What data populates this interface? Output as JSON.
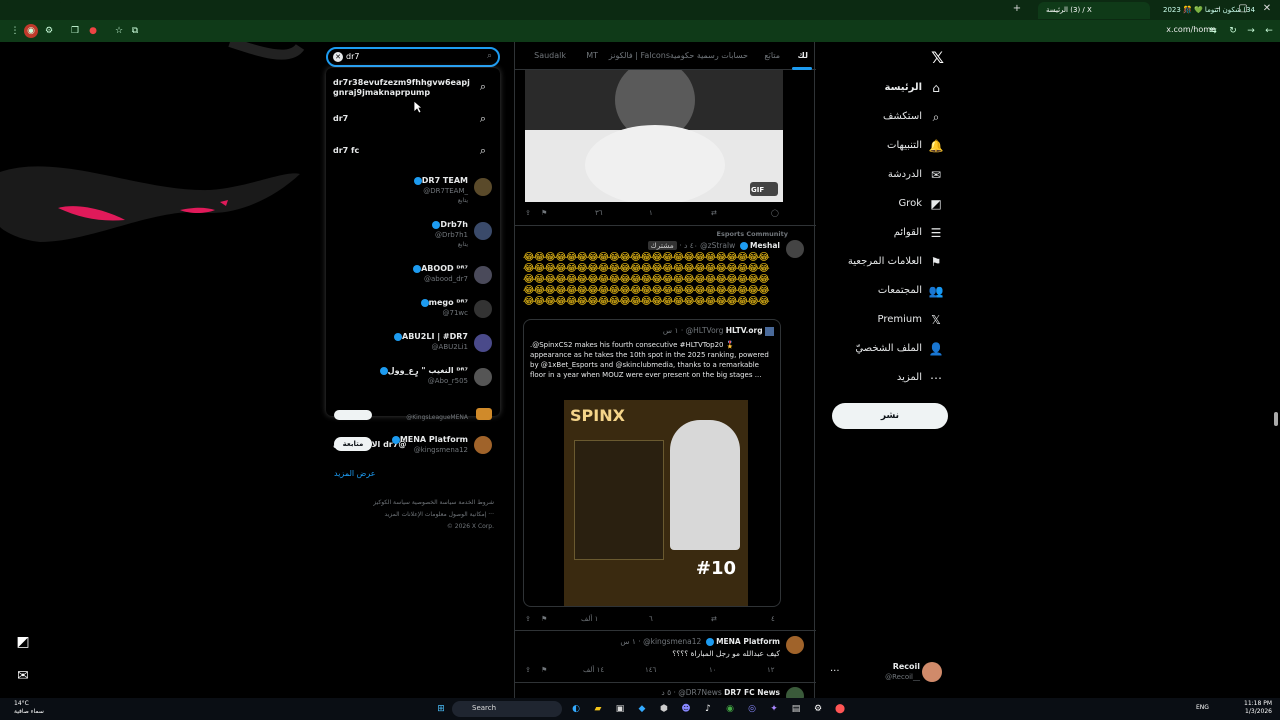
{
  "browser": {
    "tabs": [
      {
        "label": "‏(3) الرئيسة / X"
      },
      {
        "label": "‏(34) شكون انتوما 💚 🎊 2023"
      }
    ],
    "url": "x.com/home"
  },
  "search": {
    "query": "dr7",
    "suggestions": [
      {
        "text": "dr7r38evufzezm9fhhgvw6eapjgnraj9jmaknaprpump"
      },
      {
        "text": "dr7"
      },
      {
        "text": "dr7 fc"
      }
    ],
    "accounts": [
      {
        "name": "DR7 TEAM",
        "handle": "@DR7TEAM_",
        "sub": "يتابع"
      },
      {
        "name": "Drb7h",
        "handle": "@Drb7h1",
        "sub": "يتابع"
      },
      {
        "name": "ABOOD ᴰᴿ⁷",
        "handle": "@abood_dr7",
        "sub": ""
      },
      {
        "name": "mego ᴰᴿ⁷",
        "handle": "@71wc",
        "sub": ""
      },
      {
        "name": "ABU2LI | #DR7",
        "handle": "@ABU2Li1",
        "sub": ""
      },
      {
        "name": "النغيب \" رٍع_وول ᴰᴿ⁷",
        "handle": "@Abo_r505",
        "sub": ""
      }
    ],
    "goto": "الانتقال إلى dr7@"
  },
  "who_to_follow": {
    "row1_handle": "@KingsLeagueMENA",
    "row2": {
      "name": "MENA Platform",
      "handle": "@kingsmena12",
      "button": "متابعة"
    },
    "show_more": "عرض المزيد"
  },
  "footer": {
    "line1": "شروط الخدمة   سياسة الخصوصية   سياسة الكوكيز",
    "line2": "إمكانية الوصول   معلومات الإعلانات   المزيد ···",
    "line3": "© 2026 X Corp."
  },
  "timeline": {
    "tabs": [
      "لك",
      "متابَع",
      "حسابات رسمية حكومية",
      "فالكونز | Falcons",
      "MT",
      "Saudalk"
    ],
    "tweet1": {
      "gif": "GIF",
      "replies": "",
      "retweets": "",
      "likes": "١",
      "views": "٣٦"
    },
    "community": "Esports Community",
    "tweet2": {
      "name": "Meshal",
      "handle": "@zStralw",
      "badge": "مشترك",
      "time": "٤٠ د",
      "emoji": "😂😂😂😂😂😂😂😂😂😂😂😂😂😂😂😂😂😂😂😂😂😂😂😂😂😂😂😂😂😂😂😂😂😂😂😂😂😂😂😂😂😂😂😂😂😂😂😂😂😂😂😂😂😂😂😂😂😂😂😂😂😂😂😂😂😂😂😂😂😂😂😂😂😂😂😂😂😂😂😂😂😂😂😂😂😂😂😂😂😂😂😂😂😂😂😂😂😂😂😂😂😂😂😂😂😂😂😂😂😂😂😂😂😂😂",
      "quote": {
        "name": "HLTV.org",
        "handle": "@HLTVorg",
        "time": "١ س",
        "text": ".@SpinxCS2 makes his fourth consecutive #HLTVTop20 🎖️ appearance as he takes the 10th spot in the 2025 ranking, powered by @1xBet_Esports and @skinclubmedia, thanks to a remarkable floor in a year when MOUZ were ever present on the big stages ...",
        "image_title": "SPINX",
        "image_rank": "#10"
      },
      "replies": "٤",
      "retweets": "",
      "likes": "٦",
      "views": "١ ألف"
    },
    "tweet3": {
      "name": "MENA Platform",
      "handle": "@kingsmena12",
      "time": "١ س",
      "text": "كيف عبدالله مو رجل المباراة ؟؟؟؟",
      "replies": "١٢",
      "retweets": "١٠",
      "likes": "١٤٦",
      "views": "١٤ ألف"
    },
    "tweet4": {
      "name": "DR7 FC News",
      "handle": "@DR7News",
      "time": "٥ د"
    }
  },
  "nav": {
    "items": [
      {
        "label": "الرئيسة",
        "icon": "home-icon",
        "glyph": "⌂"
      },
      {
        "label": "استكشف",
        "icon": "search-icon",
        "glyph": "⌕"
      },
      {
        "label": "التنبيهات",
        "icon": "bell-icon",
        "glyph": "🔔"
      },
      {
        "label": "الدردشة",
        "icon": "mail-icon",
        "glyph": "✉"
      },
      {
        "label": "Grok",
        "icon": "grok-icon",
        "glyph": "◩"
      },
      {
        "label": "القوائم",
        "icon": "list-icon",
        "glyph": "☰"
      },
      {
        "label": "العلامات المرجعية",
        "icon": "bookmark-icon",
        "glyph": "⚑"
      },
      {
        "label": "المجتمعات",
        "icon": "communities-icon",
        "glyph": "👥"
      },
      {
        "label": "Premium",
        "icon": "x-logo-icon",
        "glyph": "𝕏"
      },
      {
        "label": "الملف الشخصيّ",
        "icon": "profile-icon",
        "glyph": "👤"
      },
      {
        "label": "المزيد",
        "icon": "more-icon",
        "glyph": "⋯"
      }
    ],
    "post": "نشر",
    "profile": {
      "name": "Recoil",
      "handle": "@Recoil__"
    }
  },
  "taskbar": {
    "search": "Search",
    "weather": "14°C",
    "weather_desc": "سماء صافية",
    "lang": "ENG",
    "time": "11:18 PM",
    "date": "1/3/2026"
  },
  "colors": {
    "accent": "#1d9bf0",
    "bg": "#000000",
    "chrome": "#0f3a18"
  }
}
